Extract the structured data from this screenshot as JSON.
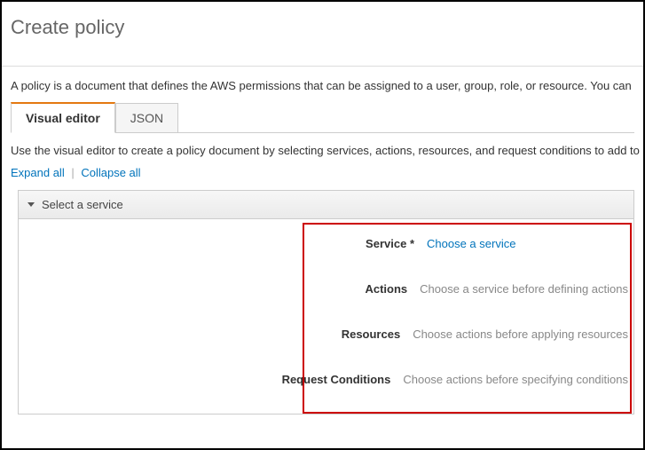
{
  "page_title": "Create policy",
  "intro": "A policy is a document that defines the AWS permissions that can be assigned to a user, group, role, or resource. You can ",
  "tabs": {
    "visual_editor": "Visual editor",
    "json": "JSON"
  },
  "sub_intro": "Use the visual editor to create a policy document by selecting services, actions, resources, and request conditions to add to",
  "expand": {
    "expand_all": "Expand all",
    "collapse_all": "Collapse all"
  },
  "accordion": {
    "title": "Select a service"
  },
  "rows": {
    "service": {
      "label": "Service",
      "required": "*",
      "value": "Choose a service"
    },
    "actions": {
      "label": "Actions",
      "value": "Choose a service before defining actions"
    },
    "resources": {
      "label": "Resources",
      "value": "Choose actions before applying resources"
    },
    "conditions": {
      "label": "Request Conditions",
      "value": "Choose actions before specifying conditions"
    }
  }
}
